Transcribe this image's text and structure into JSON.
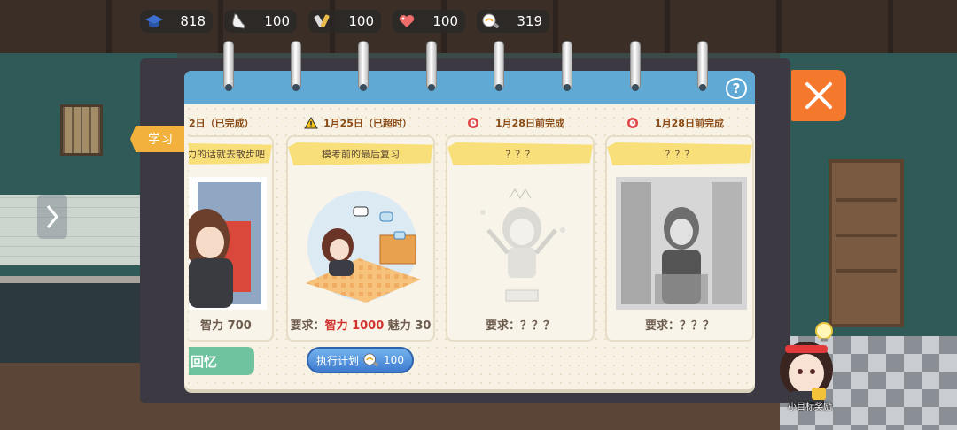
{
  "resources": [
    {
      "icon": "graduation-cap-icon",
      "value": "818"
    },
    {
      "icon": "shoe-icon",
      "value": "100"
    },
    {
      "icon": "tool-icon",
      "value": "100"
    },
    {
      "icon": "heart-icon",
      "value": "100"
    },
    {
      "icon": "idea-icon",
      "value": "319"
    }
  ],
  "side_tab": {
    "label": "学习"
  },
  "cards": [
    {
      "date": "2日（已完成）",
      "title": "力的话就去散步吧",
      "req_prefix": "智力 700",
      "req_highlight": "",
      "req_suffix": "",
      "status": "completed"
    },
    {
      "date": "1月25日（已超时）",
      "title": "模考前的最后复习",
      "req_prefix": "要求：",
      "req_highlight": "智力 1000",
      "req_suffix": " 魅力 30",
      "status": "overdue"
    },
    {
      "date": "1月28日前完成",
      "title": "？？？",
      "req_prefix": "要求：？？？",
      "req_highlight": "",
      "req_suffix": "",
      "status": "locked"
    },
    {
      "date": "1月28日前完成",
      "title": "？？？",
      "req_prefix": "要求：？？？",
      "req_highlight": "",
      "req_suffix": "",
      "status": "locked"
    }
  ],
  "exec_button": {
    "label": "执行计划",
    "cost": "100"
  },
  "recall_button": {
    "label": "回忆"
  },
  "goal_reward": {
    "label": "小目标奖励"
  },
  "help": {
    "label": "?"
  },
  "colors": {
    "accent_orange": "#f4792d",
    "header_blue": "#5fa9d4",
    "highlight_red": "#d2332f",
    "tab_yellow": "#f2b13d"
  }
}
